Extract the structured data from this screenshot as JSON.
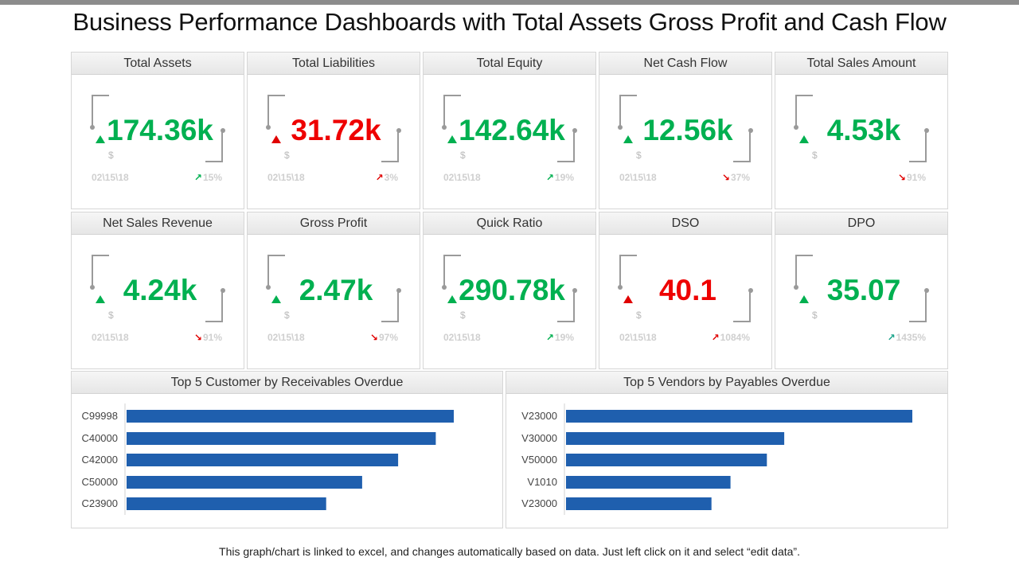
{
  "title": "Business Performance Dashboards with Total Assets Gross Profit and Cash Flow",
  "kpis": [
    {
      "label": "Total Assets",
      "value": "174.36k",
      "value_color": "green",
      "trend": "up-green",
      "unit": "$",
      "date": "02\\15\\18",
      "delta": "15%",
      "delta_arrow": "↗",
      "delta_color": "g"
    },
    {
      "label": "Total Liabilities",
      "value": "31.72k",
      "value_color": "red",
      "trend": "up-red",
      "unit": "$",
      "date": "02\\15\\18",
      "delta": "3%",
      "delta_arrow": "↗",
      "delta_color": "r"
    },
    {
      "label": "Total Equity",
      "value": "142.64k",
      "value_color": "green",
      "trend": "up-green",
      "unit": "$",
      "date": "02\\15\\18",
      "delta": "19%",
      "delta_arrow": "↗",
      "delta_color": "g"
    },
    {
      "label": "Net Cash Flow",
      "value": "12.56k",
      "value_color": "green",
      "trend": "up-green",
      "unit": "$",
      "date": "02\\15\\18",
      "delta": "37%",
      "delta_arrow": "↘",
      "delta_color": "r"
    },
    {
      "label": "Total Sales Amount",
      "value": "4.53k",
      "value_color": "green",
      "trend": "up-green",
      "unit": "$",
      "date": "",
      "delta": "91%",
      "delta_arrow": "↘",
      "delta_color": "r"
    },
    {
      "label": "Net Sales Revenue",
      "value": "4.24k",
      "value_color": "green",
      "trend": "up-green",
      "unit": "$",
      "date": "02\\15\\18",
      "delta": "91%",
      "delta_arrow": "↘",
      "delta_color": "r"
    },
    {
      "label": "Gross Profit",
      "value": "2.47k",
      "value_color": "green",
      "trend": "up-green",
      "unit": "$",
      "date": "02\\15\\18",
      "delta": "97%",
      "delta_arrow": "↘",
      "delta_color": "r"
    },
    {
      "label": "Quick Ratio",
      "value": "290.78k",
      "value_color": "green",
      "trend": "up-green",
      "unit": "$",
      "date": "02\\15\\18",
      "delta": "19%",
      "delta_arrow": "↗",
      "delta_color": "g"
    },
    {
      "label": "DSO",
      "value": "40.1",
      "value_color": "red",
      "trend": "up-red",
      "unit": "$",
      "date": "02\\15\\18",
      "delta": "1084%",
      "delta_arrow": "↗",
      "delta_color": "r"
    },
    {
      "label": "DPO",
      "value": "35.07",
      "value_color": "green",
      "trend": "up-green",
      "unit": "$",
      "date": "",
      "delta": "1435%",
      "delta_arrow": "↗",
      "delta_color": "t"
    }
  ],
  "chart_data": [
    {
      "type": "bar",
      "orientation": "horizontal",
      "title": "Top 5 Customer by Receivables Overdue",
      "categories": [
        "C99998",
        "C40000",
        "C42000",
        "C50000",
        "C23900"
      ],
      "values": [
        100,
        94.5,
        83,
        72,
        61
      ],
      "xlim": [
        0,
        100
      ],
      "color": "#1f5fae",
      "grid": false
    },
    {
      "type": "bar",
      "orientation": "horizontal",
      "title": "Top 5 Vendors by Payables Overdue",
      "categories": [
        "V23000",
        "V30000",
        "V50000",
        "V1010",
        "V23000"
      ],
      "values": [
        100,
        63,
        58,
        47.5,
        42
      ],
      "xlim": [
        0,
        100
      ],
      "color": "#1f5fae",
      "grid": false
    }
  ],
  "footnote": "This graph/chart is linked to excel, and changes automatically  based on data. Just left click on it and select “edit data”."
}
